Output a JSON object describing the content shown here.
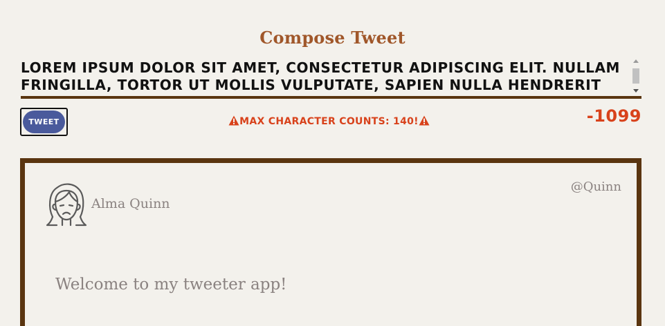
{
  "compose": {
    "title": "Compose Tweet",
    "textarea_value": "Lorem ipsum dolor sit amet, consectetur adipiscing elit. Nullam fringilla, tortor ut mollis vulputate, sapien nulla hendrerit"
  },
  "actions": {
    "tweet_label": "Tweet",
    "warning_text": "Max character counts: 140!",
    "counter": "-1099"
  },
  "tweet": {
    "name": "Alma Quinn",
    "handle": "@Quinn",
    "text": "Welcome to my tweeter app!"
  },
  "colors": {
    "title": "#a0572a",
    "border": "#5a3510",
    "button": "#4a5a9c",
    "warning": "#d8421b",
    "muted_text": "#8a8280",
    "background": "#f3f1ec"
  },
  "icons": {
    "warning": "warning-triangle-icon",
    "avatar": "sad-face-avatar-icon"
  }
}
